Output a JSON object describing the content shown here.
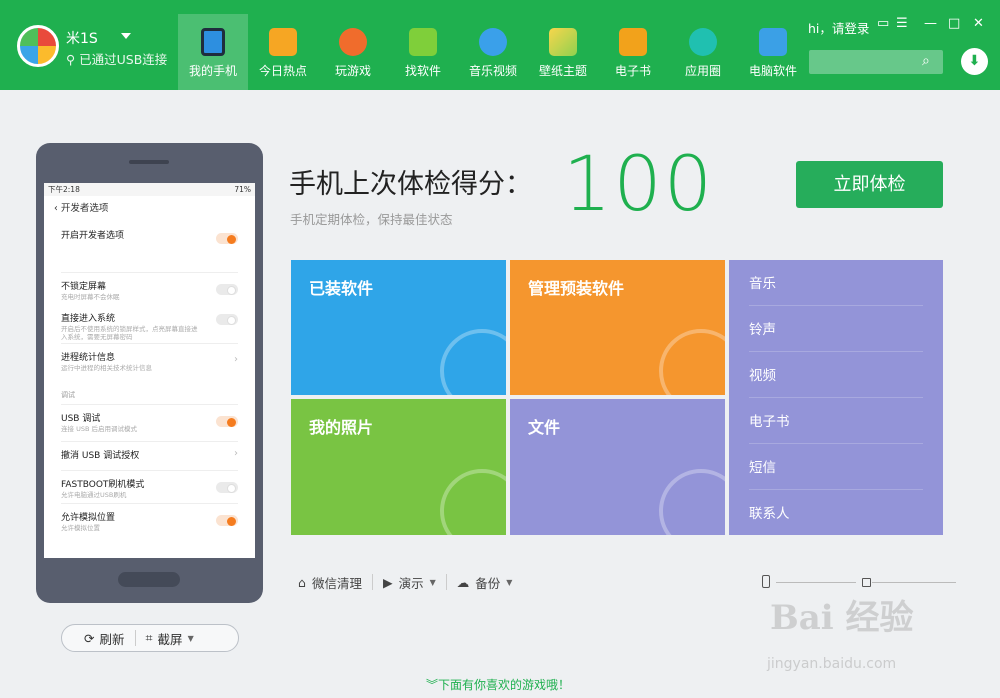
{
  "device": {
    "name": "米1S",
    "status": "已通过USB连接"
  },
  "nav": [
    {
      "label": "我的手机",
      "icon": "phone-icon",
      "active": true
    },
    {
      "label": "今日热点",
      "icon": "star-icon"
    },
    {
      "label": "玩游戏",
      "icon": "gamepad-icon"
    },
    {
      "label": "找软件",
      "icon": "android-icon"
    },
    {
      "label": "音乐视频",
      "icon": "play-icon"
    },
    {
      "label": "壁纸主题",
      "icon": "wallpaper-icon"
    },
    {
      "label": "电子书",
      "icon": "book-icon"
    },
    {
      "label": "应用圈",
      "icon": "circle-icon"
    },
    {
      "label": "电脑软件",
      "icon": "windows-icon"
    }
  ],
  "header": {
    "login": "hi，请登录",
    "search_placeholder": ""
  },
  "colors": {
    "brand": "#1fb04f",
    "score": "#1fb04f",
    "tile_blue": "#2fa5e8",
    "tile_orange": "#f5962e",
    "tile_green": "#79c443",
    "tile_purple": "#9394d8"
  },
  "phone_screen": {
    "time": "下午2:18",
    "battery": "71%",
    "title": "开发者选项",
    "rows": [
      {
        "title": "开启开发者选项",
        "subtitle": "",
        "control": "toggle-on"
      },
      {
        "title": "不锁定屏幕",
        "subtitle": "充电时屏幕不会休眠",
        "control": "toggle-off"
      },
      {
        "title": "直接进入系统",
        "subtitle": "开启后不使用系统的锁屏样式，点亮屏幕直接进入系统，需要无屏幕密码",
        "control": "toggle-off"
      },
      {
        "title": "进程统计信息",
        "subtitle": "运行中进程的相关技术统计信息",
        "control": "chevron"
      },
      {
        "title": "USB 调试",
        "subtitle": "连接 USB 后启用调试模式",
        "control": "toggle-on"
      },
      {
        "title": "撤消 USB 调试授权",
        "subtitle": "",
        "control": "chevron"
      },
      {
        "title": "FASTBOOT刷机模式",
        "subtitle": "允许电脑通过USB刷机",
        "control": "toggle-off"
      },
      {
        "title": "允许模拟位置",
        "subtitle": "允许模拟位置",
        "control": "toggle-on"
      }
    ],
    "section_debug": "调试"
  },
  "phone_actions": {
    "refresh": "刷新",
    "screenshot": "截屏"
  },
  "score": {
    "title": "手机上次体检得分：",
    "subtitle": "手机定期体检，保持最佳状态",
    "value": "100",
    "button": "立即体检"
  },
  "tiles": {
    "installed": "已装软件",
    "preinstalled": "管理预装软件",
    "photos": "我的照片",
    "files": "文件"
  },
  "media": [
    "音乐",
    "铃声",
    "视频",
    "电子书",
    "短信",
    "联系人"
  ],
  "toolbar": {
    "wechat_clean": "微信清理",
    "demo": "演示",
    "backup": "备份"
  },
  "bottom_link": "下面有你喜欢的游戏哦！",
  "watermark": {
    "main": "Bai 经验",
    "url": "jingyan.baidu.com"
  }
}
